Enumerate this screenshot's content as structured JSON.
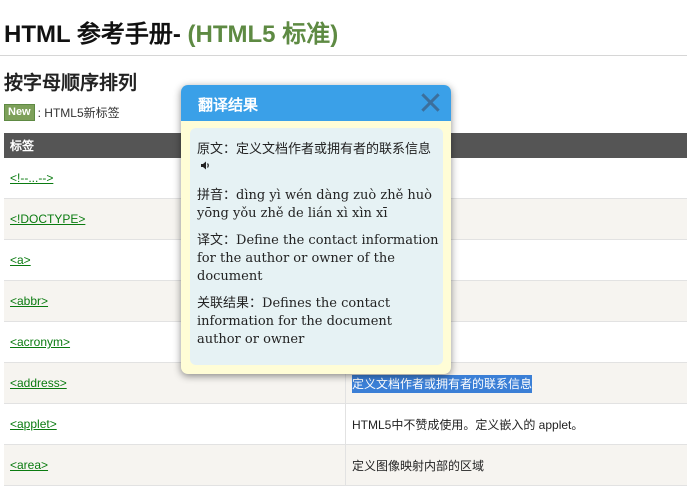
{
  "page": {
    "title_main": "HTML 参考手册- ",
    "title_highlight": "(HTML5 标准)",
    "section_title": "按字母顺序排列",
    "new_badge": "New",
    "new_legend": ": HTML5新标签"
  },
  "table": {
    "header_tag": "标签",
    "rows": [
      {
        "tag": "<!--...-->",
        "desc": ""
      },
      {
        "tag": "<!DOCTYPE>",
        "desc": ""
      },
      {
        "tag": "<a>",
        "desc": ""
      },
      {
        "tag": "<abbr>",
        "desc": ""
      },
      {
        "tag": "<acronym>",
        "desc": ""
      },
      {
        "tag": "<address>",
        "desc": "定义文档作者或拥有者的联系信息"
      },
      {
        "tag": "<applet>",
        "desc": "HTML5中不赞成使用。定义嵌入的 applet。"
      },
      {
        "tag": "<area>",
        "desc": "定义图像映射内部的区域"
      }
    ]
  },
  "popup": {
    "title": "翻译结果",
    "original_label": "原文：",
    "original_text": "定义文档作者或拥有者的联系信息",
    "pinyin_label": "拼音：",
    "pinyin_text": "dìng yì wén dàng zuò zhě huò yōng yǒu zhě de lián xì xìn xī",
    "translation_label": "译文：",
    "translation_text": "Define the contact information for the author or owner of the document",
    "related_label": "关联结果：",
    "related_text": "Defines the contact information for the document author or owner",
    "icons": [
      "close-icon",
      "speaker-icon"
    ],
    "colors": {
      "header": "#3aa0e8",
      "frame": "#fffdd6",
      "body": "#e6f2f4"
    }
  },
  "colors": {
    "accent_green": "#5e8a43",
    "link_green": "#0a7b10",
    "selection": "#3b7fd6",
    "table_header": "#555555"
  }
}
